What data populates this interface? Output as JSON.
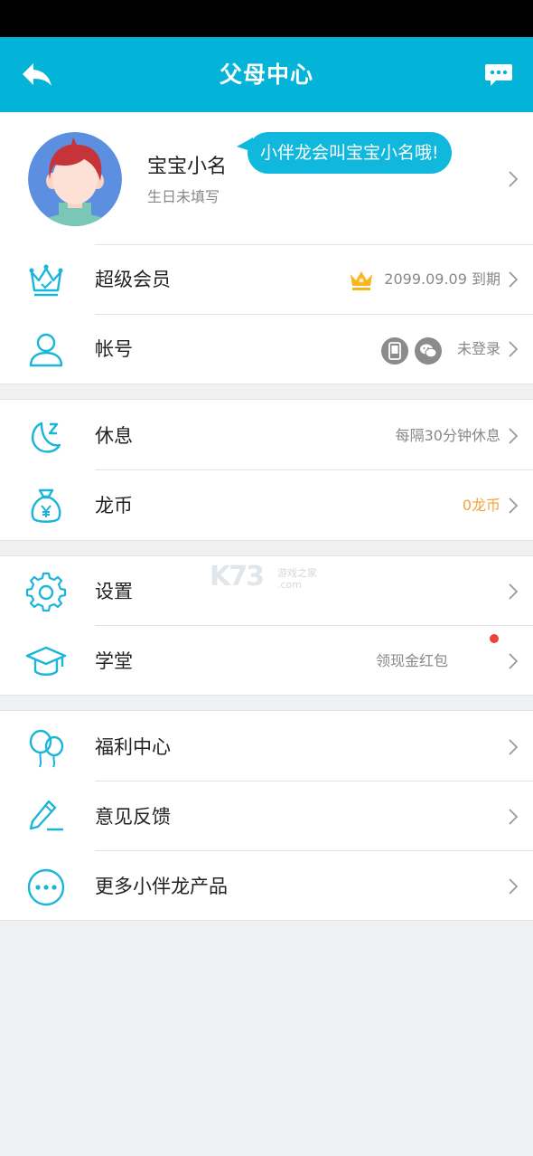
{
  "header": {
    "title": "父母中心"
  },
  "profile": {
    "name": "宝宝小名",
    "birthday": "生日未填写",
    "bubble": "小伴龙会叫宝宝小名哦!"
  },
  "section1": [
    {
      "label": "超级会员",
      "value": "2099.09.09 到期",
      "icon": "crown-icon"
    },
    {
      "label": "帐号",
      "value": "未登录",
      "icon": "user-icon"
    }
  ],
  "section2": [
    {
      "label": "休息",
      "value": "每隔30分钟休息",
      "icon": "moon-sleep-icon"
    },
    {
      "label": "龙币",
      "value": "0龙币",
      "value_color": "#f5a23c",
      "icon": "money-bag-icon"
    }
  ],
  "section3": [
    {
      "label": "设置",
      "value": "",
      "icon": "gear-icon"
    },
    {
      "label": "学堂",
      "value": "领现金红包",
      "icon": "graduation-cap-icon"
    }
  ],
  "section4": [
    {
      "label": "福利中心",
      "value": "",
      "icon": "balloon-icon"
    },
    {
      "label": "意见反馈",
      "value": "",
      "icon": "pen-edit-icon"
    },
    {
      "label": "更多小伴龙产品",
      "value": "",
      "icon": "more-dots-icon"
    }
  ],
  "watermark": {
    "big": "K73",
    "line1": "游戏之家",
    "line2": ".com"
  },
  "colors": {
    "accent": "#03b4d8",
    "icon": "#1ab6d9",
    "coin": "#f5a23c",
    "dot": "#f04038"
  }
}
